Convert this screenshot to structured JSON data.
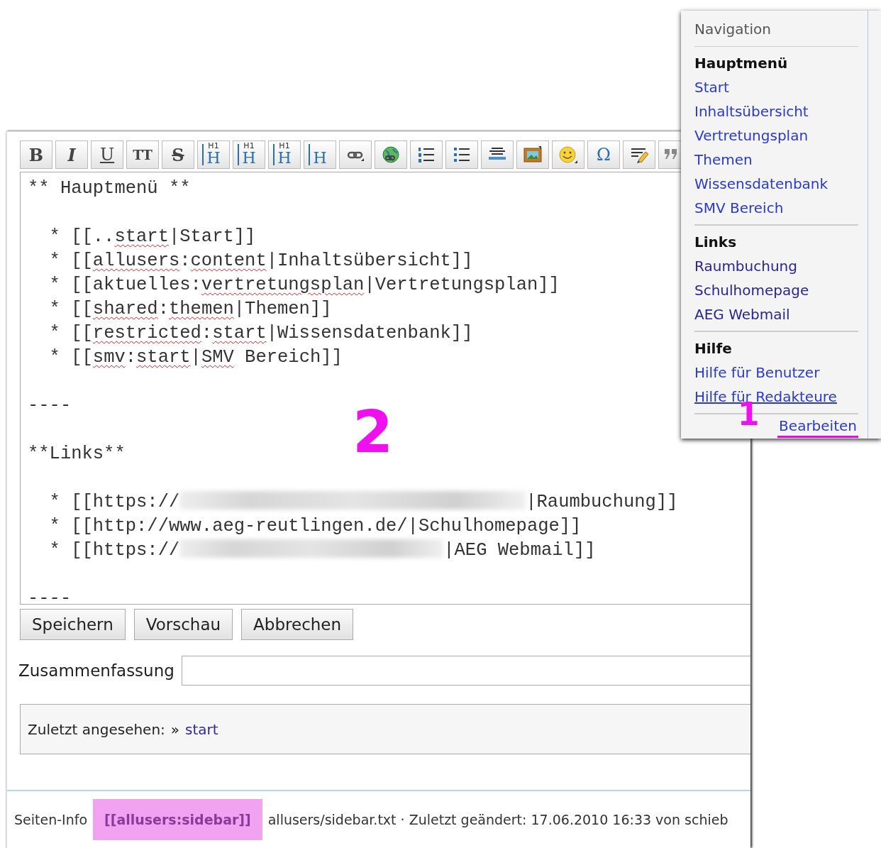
{
  "toolbar": {
    "buttons": [
      {
        "kind": "bold",
        "label": "B"
      },
      {
        "kind": "italic",
        "label": "I"
      },
      {
        "kind": "underline",
        "label": "U"
      },
      {
        "kind": "mono",
        "label": "TT"
      },
      {
        "kind": "strike",
        "label": "S"
      },
      {
        "kind": "heading-same",
        "label": "H",
        "sup": "H1"
      },
      {
        "kind": "heading-lower",
        "label": "H",
        "sup": "H1"
      },
      {
        "kind": "heading-higher",
        "label": "H",
        "sup": "H1"
      },
      {
        "kind": "heading-menu",
        "label": "H"
      },
      {
        "kind": "link"
      },
      {
        "kind": "ext-link"
      },
      {
        "kind": "ordered-list"
      },
      {
        "kind": "unordered-list"
      },
      {
        "kind": "rule"
      },
      {
        "kind": "image"
      },
      {
        "kind": "smiley"
      },
      {
        "kind": "special-chars",
        "label": "Ω"
      },
      {
        "kind": "signature"
      },
      {
        "kind": "quote"
      }
    ]
  },
  "editor": {
    "lines": [
      {
        "kind": "text",
        "segments": [
          {
            "kind": "text",
            "text": "** Hauptmenü **"
          }
        ]
      },
      {
        "kind": "blank"
      },
      {
        "kind": "text",
        "segments": [
          {
            "kind": "text",
            "text": "  * [[.."
          },
          {
            "kind": "text",
            "text": "start",
            "misspelled": true
          },
          {
            "kind": "text",
            "text": "|Start]]"
          }
        ]
      },
      {
        "kind": "text",
        "segments": [
          {
            "kind": "text",
            "text": "  * [["
          },
          {
            "kind": "text",
            "text": "allusers",
            "misspelled": true
          },
          {
            "kind": "text",
            "text": ":"
          },
          {
            "kind": "text",
            "text": "content",
            "misspelled": true
          },
          {
            "kind": "text",
            "text": "|Inhaltsübersicht]]"
          }
        ]
      },
      {
        "kind": "text",
        "segments": [
          {
            "kind": "text",
            "text": "  * [[aktuelles:"
          },
          {
            "kind": "text",
            "text": "vertretungsplan",
            "misspelled": true
          },
          {
            "kind": "text",
            "text": "|Vertretungsplan]]"
          }
        ]
      },
      {
        "kind": "text",
        "segments": [
          {
            "kind": "text",
            "text": "  * [["
          },
          {
            "kind": "text",
            "text": "shared",
            "misspelled": true
          },
          {
            "kind": "text",
            "text": ":"
          },
          {
            "kind": "text",
            "text": "themen",
            "misspelled": true
          },
          {
            "kind": "text",
            "text": "|Themen]]"
          }
        ]
      },
      {
        "kind": "text",
        "segments": [
          {
            "kind": "text",
            "text": "  * [["
          },
          {
            "kind": "text",
            "text": "restricted",
            "misspelled": true
          },
          {
            "kind": "text",
            "text": ":"
          },
          {
            "kind": "text",
            "text": "start",
            "misspelled": true
          },
          {
            "kind": "text",
            "text": "|Wissensdatenbank]]"
          }
        ]
      },
      {
        "kind": "text",
        "segments": [
          {
            "kind": "text",
            "text": "  * [["
          },
          {
            "kind": "text",
            "text": "smv",
            "misspelled": true
          },
          {
            "kind": "text",
            "text": ":"
          },
          {
            "kind": "text",
            "text": "start",
            "misspelled": true
          },
          {
            "kind": "text",
            "text": "|"
          },
          {
            "kind": "text",
            "text": "SMV",
            "misspelled": true
          },
          {
            "kind": "text",
            "text": " Bereich]]"
          }
        ]
      },
      {
        "kind": "blank"
      },
      {
        "kind": "text",
        "segments": [
          {
            "kind": "text",
            "text": "----"
          }
        ]
      },
      {
        "kind": "blank"
      },
      {
        "kind": "text",
        "segments": [
          {
            "kind": "text",
            "text": "**Links**"
          }
        ]
      },
      {
        "kind": "blank"
      },
      {
        "kind": "text",
        "segments": [
          {
            "kind": "text",
            "text": "  * [[https://"
          },
          {
            "kind": "redacted"
          },
          {
            "kind": "text",
            "text": "|Raumbuchung]]"
          }
        ]
      },
      {
        "kind": "text",
        "segments": [
          {
            "kind": "text",
            "text": "  * [[http://www.aeg-reutlingen.de/|Schulhomepage]]"
          }
        ]
      },
      {
        "kind": "text",
        "segments": [
          {
            "kind": "text",
            "text": "  * [[https://"
          },
          {
            "kind": "redacted"
          },
          {
            "kind": "text",
            "text": "|AEG Webmail]]"
          }
        ]
      },
      {
        "kind": "blank"
      },
      {
        "kind": "text",
        "segments": [
          {
            "kind": "text",
            "text": "----"
          }
        ]
      }
    ]
  },
  "buttons": [
    {
      "label": "Speichern"
    },
    {
      "label": "Vorschau"
    },
    {
      "label": "Abbrechen"
    }
  ],
  "summary": {
    "label": "Zusammenfassung"
  },
  "breadcrumbs": {
    "label": "Zuletzt angesehen:",
    "separator": "»",
    "items": [
      {
        "label": "start"
      }
    ]
  },
  "footer": {
    "info_label": "Seiten-Info",
    "page_id": "[[allusers:sidebar]]",
    "page_id_highlighted": true,
    "details": "allusers/sidebar.txt · Zuletzt geändert: 17.06.2010 16:33 von schieb"
  },
  "sidebar": {
    "title": "Navigation",
    "sections": [
      {
        "heading": "Hauptmenü",
        "links": [
          {
            "label": "Start",
            "visited": false,
            "hovered": false
          },
          {
            "label": "Inhaltsübersicht",
            "visited": false,
            "hovered": false
          },
          {
            "label": "Vertretungsplan",
            "visited": false,
            "hovered": false
          },
          {
            "label": "Themen",
            "visited": false,
            "hovered": false
          },
          {
            "label": "Wissensdatenbank",
            "visited": false,
            "hovered": false
          },
          {
            "label": "SMV Bereich",
            "visited": false,
            "hovered": false
          }
        ]
      },
      {
        "heading": "Links",
        "links": [
          {
            "label": "Raumbuchung",
            "visited": true,
            "hovered": false
          },
          {
            "label": "Schulhomepage",
            "visited": true,
            "hovered": false
          },
          {
            "label": "AEG Webmail",
            "visited": true,
            "hovered": false
          }
        ]
      },
      {
        "heading": "Hilfe",
        "links": [
          {
            "label": "Hilfe für Benutzer",
            "visited": false,
            "hovered": false
          },
          {
            "label": "Hilfe für Redakteure",
            "visited": false,
            "hovered": true
          }
        ]
      }
    ],
    "edit_link": {
      "label": "Bearbeiten",
      "underlined": true
    }
  },
  "annotations": [
    {
      "label": "2"
    },
    {
      "label": "1"
    }
  ]
}
